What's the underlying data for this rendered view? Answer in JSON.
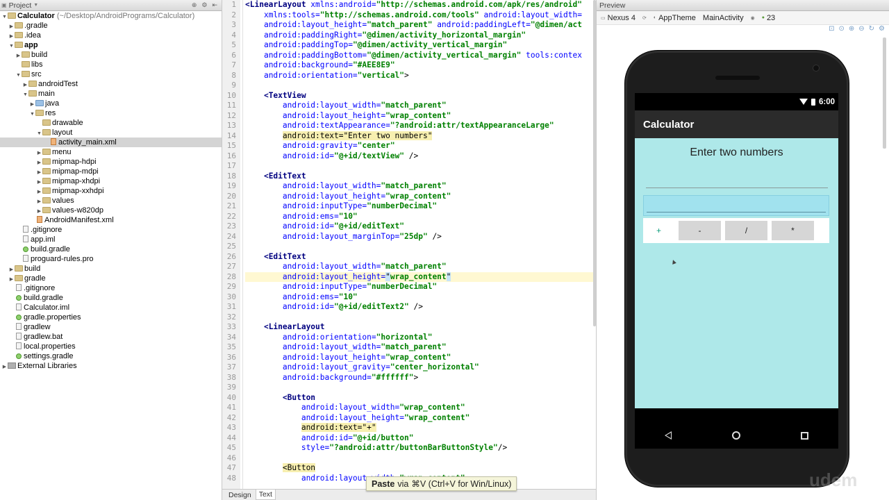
{
  "project_panel": {
    "title": "Project",
    "tree": [
      {
        "label": "Calculator",
        "sub": " (~/Desktop/AndroidPrograms/Calculator)",
        "depth": 0,
        "arrow": "down",
        "icon": "folder",
        "bold": true
      },
      {
        "label": ".gradle",
        "depth": 1,
        "arrow": "right",
        "icon": "folder"
      },
      {
        "label": ".idea",
        "depth": 1,
        "arrow": "right",
        "icon": "folder"
      },
      {
        "label": "app",
        "depth": 1,
        "arrow": "down",
        "icon": "folder",
        "bold": true
      },
      {
        "label": "build",
        "depth": 2,
        "arrow": "right",
        "icon": "folder"
      },
      {
        "label": "libs",
        "depth": 2,
        "arrow": "",
        "icon": "folder"
      },
      {
        "label": "src",
        "depth": 2,
        "arrow": "down",
        "icon": "folder"
      },
      {
        "label": "androidTest",
        "depth": 3,
        "arrow": "right",
        "icon": "folder"
      },
      {
        "label": "main",
        "depth": 3,
        "arrow": "down",
        "icon": "folder"
      },
      {
        "label": "java",
        "depth": 4,
        "arrow": "right",
        "icon": "srcfolder"
      },
      {
        "label": "res",
        "depth": 4,
        "arrow": "down",
        "icon": "folder"
      },
      {
        "label": "drawable",
        "depth": 5,
        "arrow": "",
        "icon": "folder"
      },
      {
        "label": "layout",
        "depth": 5,
        "arrow": "down",
        "icon": "folder"
      },
      {
        "label": "activity_main.xml",
        "depth": 6,
        "arrow": "",
        "icon": "xml",
        "selected": true
      },
      {
        "label": "menu",
        "depth": 5,
        "arrow": "right",
        "icon": "folder"
      },
      {
        "label": "mipmap-hdpi",
        "depth": 5,
        "arrow": "right",
        "icon": "folder"
      },
      {
        "label": "mipmap-mdpi",
        "depth": 5,
        "arrow": "right",
        "icon": "folder"
      },
      {
        "label": "mipmap-xhdpi",
        "depth": 5,
        "arrow": "right",
        "icon": "folder"
      },
      {
        "label": "mipmap-xxhdpi",
        "depth": 5,
        "arrow": "right",
        "icon": "folder"
      },
      {
        "label": "values",
        "depth": 5,
        "arrow": "right",
        "icon": "folder"
      },
      {
        "label": "values-w820dp",
        "depth": 5,
        "arrow": "right",
        "icon": "folder"
      },
      {
        "label": "AndroidManifest.xml",
        "depth": 4,
        "arrow": "",
        "icon": "xml"
      },
      {
        "label": ".gitignore",
        "depth": 2,
        "arrow": "",
        "icon": "file"
      },
      {
        "label": "app.iml",
        "depth": 2,
        "arrow": "",
        "icon": "file"
      },
      {
        "label": "build.gradle",
        "depth": 2,
        "arrow": "",
        "icon": "gradle"
      },
      {
        "label": "proguard-rules.pro",
        "depth": 2,
        "arrow": "",
        "icon": "file"
      },
      {
        "label": "build",
        "depth": 1,
        "arrow": "right",
        "icon": "folder"
      },
      {
        "label": "gradle",
        "depth": 1,
        "arrow": "right",
        "icon": "folder"
      },
      {
        "label": ".gitignore",
        "depth": 1,
        "arrow": "",
        "icon": "file"
      },
      {
        "label": "build.gradle",
        "depth": 1,
        "arrow": "",
        "icon": "gradle"
      },
      {
        "label": "Calculator.iml",
        "depth": 1,
        "arrow": "",
        "icon": "file"
      },
      {
        "label": "gradle.properties",
        "depth": 1,
        "arrow": "",
        "icon": "gradle"
      },
      {
        "label": "gradlew",
        "depth": 1,
        "arrow": "",
        "icon": "file"
      },
      {
        "label": "gradlew.bat",
        "depth": 1,
        "arrow": "",
        "icon": "file"
      },
      {
        "label": "local.properties",
        "depth": 1,
        "arrow": "",
        "icon": "file"
      },
      {
        "label": "settings.gradle",
        "depth": 1,
        "arrow": "",
        "icon": "gradle"
      },
      {
        "label": "External Libraries",
        "depth": 0,
        "arrow": "right",
        "icon": "lib"
      }
    ]
  },
  "editor": {
    "current_line": 28,
    "lines": [
      {
        "n": "1",
        "seg": [
          [
            "tg",
            "<LinearLayout "
          ],
          [
            "at",
            "xmlns:android="
          ],
          [
            "vl",
            "\"http://schemas.android.com/apk/res/android\""
          ]
        ]
      },
      {
        "n": "2",
        "seg": [
          [
            "t",
            "    "
          ],
          [
            "at",
            "xmlns:tools="
          ],
          [
            "vl",
            "\"http://schemas.android.com/tools\" "
          ],
          [
            "at",
            "android:layout_width="
          ]
        ]
      },
      {
        "n": "3",
        "seg": [
          [
            "t",
            "    "
          ],
          [
            "at",
            "android:layout_height="
          ],
          [
            "vl",
            "\"match_parent\" "
          ],
          [
            "at",
            "android:paddingLeft="
          ],
          [
            "vl",
            "\"@dimen/act"
          ]
        ]
      },
      {
        "n": "4",
        "seg": [
          [
            "t",
            "    "
          ],
          [
            "at",
            "android:paddingRight="
          ],
          [
            "vl",
            "\"@dimen/activity_horizontal_margin\""
          ]
        ]
      },
      {
        "n": "5",
        "seg": [
          [
            "t",
            "    "
          ],
          [
            "at",
            "android:paddingTop="
          ],
          [
            "vl",
            "\"@dimen/activity_vertical_margin\""
          ]
        ]
      },
      {
        "n": "6",
        "seg": [
          [
            "t",
            "    "
          ],
          [
            "at",
            "android:paddingBottom="
          ],
          [
            "vl",
            "\"@dimen/activity_vertical_margin\" "
          ],
          [
            "at",
            "tools:contex"
          ]
        ]
      },
      {
        "n": "7",
        "seg": [
          [
            "t",
            "    "
          ],
          [
            "at",
            "android:background="
          ],
          [
            "vl",
            "\"#AEE8E9\""
          ]
        ]
      },
      {
        "n": "8",
        "seg": [
          [
            "t",
            "    "
          ],
          [
            "at",
            "android:orientation="
          ],
          [
            "vl",
            "\"vertical\""
          ],
          [
            "t",
            ">"
          ]
        ]
      },
      {
        "n": "9",
        "seg": []
      },
      {
        "n": "10",
        "seg": [
          [
            "t",
            "    "
          ],
          [
            "tg",
            "<TextView"
          ]
        ]
      },
      {
        "n": "11",
        "seg": [
          [
            "t",
            "        "
          ],
          [
            "at",
            "android:layout_width="
          ],
          [
            "vl",
            "\"match_parent\""
          ]
        ]
      },
      {
        "n": "12",
        "seg": [
          [
            "t",
            "        "
          ],
          [
            "at",
            "android:layout_height="
          ],
          [
            "vl",
            "\"wrap_content\""
          ]
        ]
      },
      {
        "n": "13",
        "seg": [
          [
            "t",
            "        "
          ],
          [
            "at",
            "android:textAppearance="
          ],
          [
            "vl",
            "\"?android:attr/textAppearanceLarge\""
          ]
        ]
      },
      {
        "n": "14",
        "seg": [
          [
            "t",
            "        "
          ],
          [
            "hl",
            "android:text=\"Enter two numbers\""
          ]
        ]
      },
      {
        "n": "15",
        "seg": [
          [
            "t",
            "        "
          ],
          [
            "at",
            "android:gravity="
          ],
          [
            "vl",
            "\"center\""
          ]
        ]
      },
      {
        "n": "16",
        "seg": [
          [
            "t",
            "        "
          ],
          [
            "at",
            "android:id="
          ],
          [
            "vl",
            "\"@+id/textView\""
          ],
          [
            "t",
            " />"
          ]
        ]
      },
      {
        "n": "17",
        "seg": []
      },
      {
        "n": "18",
        "seg": [
          [
            "t",
            "    "
          ],
          [
            "tg",
            "<EditText"
          ]
        ]
      },
      {
        "n": "19",
        "seg": [
          [
            "t",
            "        "
          ],
          [
            "at",
            "android:layout_width="
          ],
          [
            "vl",
            "\"match_parent\""
          ]
        ]
      },
      {
        "n": "20",
        "seg": [
          [
            "t",
            "        "
          ],
          [
            "at",
            "android:layout_height="
          ],
          [
            "vl",
            "\"wrap_content\""
          ]
        ]
      },
      {
        "n": "21",
        "seg": [
          [
            "t",
            "        "
          ],
          [
            "at",
            "android:inputType="
          ],
          [
            "vl",
            "\"numberDecimal\""
          ]
        ]
      },
      {
        "n": "22",
        "seg": [
          [
            "t",
            "        "
          ],
          [
            "at",
            "android:ems="
          ],
          [
            "vl",
            "\"10\""
          ]
        ]
      },
      {
        "n": "23",
        "seg": [
          [
            "t",
            "        "
          ],
          [
            "at",
            "android:id="
          ],
          [
            "vl",
            "\"@+id/editText\""
          ]
        ]
      },
      {
        "n": "24",
        "seg": [
          [
            "t",
            "        "
          ],
          [
            "at",
            "android:layout_marginTop="
          ],
          [
            "vl",
            "\"25dp\""
          ],
          [
            "t",
            " />"
          ]
        ]
      },
      {
        "n": "25",
        "seg": []
      },
      {
        "n": "26",
        "seg": [
          [
            "t",
            "    "
          ],
          [
            "tg",
            "<EditText"
          ]
        ]
      },
      {
        "n": "27",
        "seg": [
          [
            "t",
            "        "
          ],
          [
            "at",
            "android:layout_width="
          ],
          [
            "vl",
            "\"match_parent\""
          ]
        ]
      },
      {
        "n": "28",
        "seg": [
          [
            "t",
            "        "
          ],
          [
            "at",
            "android:layout_height="
          ],
          [
            "hlv",
            "\""
          ],
          [
            "vl",
            "wrap_content"
          ],
          [
            "hlv",
            "\""
          ]
        ]
      },
      {
        "n": "29",
        "seg": [
          [
            "t",
            "        "
          ],
          [
            "at",
            "android:inputType="
          ],
          [
            "vl",
            "\"numberDecimal\""
          ]
        ]
      },
      {
        "n": "30",
        "seg": [
          [
            "t",
            "        "
          ],
          [
            "at",
            "android:ems="
          ],
          [
            "vl",
            "\"10\""
          ]
        ]
      },
      {
        "n": "31",
        "seg": [
          [
            "t",
            "        "
          ],
          [
            "at",
            "android:id="
          ],
          [
            "vl",
            "\"@+id/editText2\""
          ],
          [
            "t",
            " />"
          ]
        ]
      },
      {
        "n": "32",
        "seg": []
      },
      {
        "n": "33",
        "seg": [
          [
            "t",
            "    "
          ],
          [
            "tg",
            "<LinearLayout"
          ]
        ]
      },
      {
        "n": "34",
        "seg": [
          [
            "t",
            "        "
          ],
          [
            "at",
            "android:orientation="
          ],
          [
            "vl",
            "\"horizontal\""
          ]
        ]
      },
      {
        "n": "35",
        "seg": [
          [
            "t",
            "        "
          ],
          [
            "at",
            "android:layout_width="
          ],
          [
            "vl",
            "\"match_parent\""
          ]
        ]
      },
      {
        "n": "36",
        "seg": [
          [
            "t",
            "        "
          ],
          [
            "at",
            "android:layout_height="
          ],
          [
            "vl",
            "\"wrap_content\""
          ]
        ]
      },
      {
        "n": "37",
        "seg": [
          [
            "t",
            "        "
          ],
          [
            "at",
            "android:layout_gravity="
          ],
          [
            "vl",
            "\"center_horizontal\""
          ]
        ]
      },
      {
        "n": "38",
        "seg": [
          [
            "t",
            "        "
          ],
          [
            "at",
            "android:background="
          ],
          [
            "vl",
            "\"#ffffff\""
          ],
          [
            "t",
            ">"
          ]
        ]
      },
      {
        "n": "39",
        "seg": []
      },
      {
        "n": "40",
        "seg": [
          [
            "t",
            "        "
          ],
          [
            "tg",
            "<Button"
          ]
        ]
      },
      {
        "n": "41",
        "seg": [
          [
            "t",
            "            "
          ],
          [
            "at",
            "android:layout_width="
          ],
          [
            "vl",
            "\"wrap_content\""
          ]
        ]
      },
      {
        "n": "42",
        "seg": [
          [
            "t",
            "            "
          ],
          [
            "at",
            "android:layout_height="
          ],
          [
            "vl",
            "\"wrap_content\""
          ]
        ]
      },
      {
        "n": "43",
        "seg": [
          [
            "t",
            "            "
          ],
          [
            "hl",
            "android:text=\"+\""
          ]
        ]
      },
      {
        "n": "44",
        "seg": [
          [
            "t",
            "            "
          ],
          [
            "at",
            "android:id="
          ],
          [
            "vl",
            "\"@+id/button\""
          ]
        ]
      },
      {
        "n": "45",
        "seg": [
          [
            "t",
            "            "
          ],
          [
            "at",
            "style="
          ],
          [
            "vl",
            "\"?android:attr/buttonBarButtonStyle\""
          ],
          [
            "t",
            "/>"
          ]
        ]
      },
      {
        "n": "46",
        "seg": []
      },
      {
        "n": "47",
        "seg": [
          [
            "t",
            "        "
          ],
          [
            "hl",
            "<Button"
          ]
        ]
      },
      {
        "n": "48",
        "seg": [
          [
            "t",
            "            "
          ],
          [
            "at",
            "android:layout_width="
          ],
          [
            "vl",
            "\"wrap_content\""
          ]
        ]
      }
    ],
    "tabs": [
      "Design",
      "Text"
    ],
    "active_tab": "Text"
  },
  "preview": {
    "title": "Preview",
    "toolbar": {
      "device": "Nexus 4",
      "theme": "AppTheme",
      "activity": "MainActivity",
      "api": "23"
    },
    "status_time": "6:00",
    "app_bar_title": "Calculator",
    "content_background": "#AEE8E9",
    "text_view": "Enter two numbers",
    "buttons": [
      "+",
      "-",
      "/",
      "*"
    ],
    "watermark": "udem"
  },
  "tooltip": {
    "action": "Paste",
    "via": "via",
    "shortcut": "⌘V (Ctrl+V for Win/Linux)"
  }
}
